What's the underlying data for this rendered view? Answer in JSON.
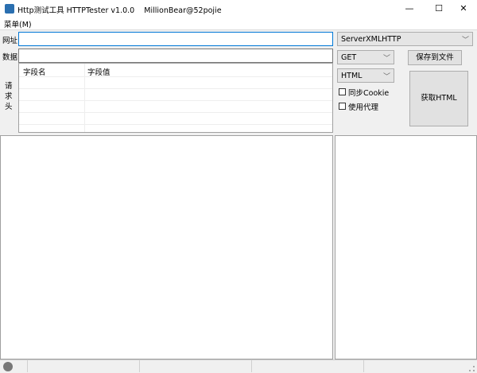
{
  "window": {
    "title": "Http测试工具 HTTPTester v1.0.0    MillionBear@52pojie",
    "minimize": "—",
    "maximize": "☐",
    "close": "✕"
  },
  "menu": {
    "label": "菜单(M)"
  },
  "form": {
    "url_label": "网址",
    "url_value": "",
    "data_label": "数据",
    "data_value": "",
    "headers_label": "请求头",
    "headers_columns": [
      "字段名",
      "字段值"
    ]
  },
  "controls": {
    "engine": "ServerXMLHTTP",
    "method": "GET",
    "format": "HTML",
    "save_button": "保存到文件",
    "fetch_button": "获取HTML",
    "sync_cookie": "同步Cookie",
    "use_proxy": "使用代理",
    "sync_cookie_checked": false,
    "use_proxy_checked": false
  }
}
